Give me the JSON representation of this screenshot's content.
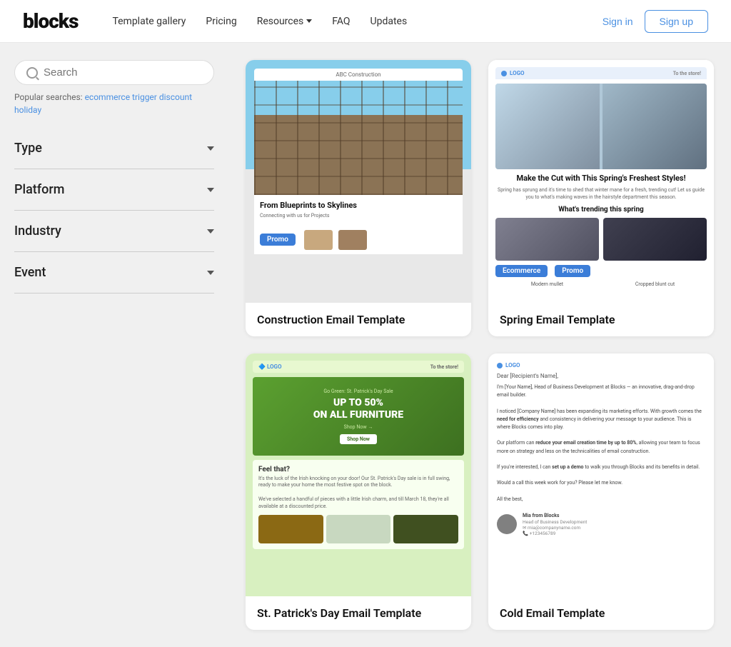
{
  "header": {
    "logo": "blocks",
    "nav": {
      "template_gallery": "Template gallery",
      "pricing": "Pricing",
      "resources": "Resources",
      "faq": "FAQ",
      "updates": "Updates",
      "sign_in": "Sign in",
      "sign_up": "Sign up"
    }
  },
  "sidebar": {
    "search": {
      "placeholder": "Search",
      "popular_label": "Popular searches:",
      "popular_links": [
        "ecommerce",
        "trigger",
        "discount",
        "holiday"
      ]
    },
    "filters": [
      {
        "label": "Type"
      },
      {
        "label": "Platform"
      },
      {
        "label": "Industry"
      },
      {
        "label": "Event"
      }
    ]
  },
  "templates": [
    {
      "id": "construction",
      "name": "Construction Email Template",
      "tags": [
        "Promo"
      ],
      "preview_company": "ABC Construction",
      "preview_tagline": "From Blueprints to Skylines"
    },
    {
      "id": "spring",
      "name": "Spring Email Template",
      "tags": [
        "Ecommerce",
        "Promo"
      ],
      "preview_heading": "Make the Cut with This Spring's Freshest Styles!",
      "preview_trending": "What's trending this spring",
      "preview_captions": [
        "Modern mullet",
        "Cropped blunt cut"
      ]
    },
    {
      "id": "stpatrick",
      "name": "St. Patrick's Day Email Template",
      "tags": [],
      "preview_company": "LOGO",
      "preview_sale": "Go Green: St. Patrick's Day Sale",
      "preview_offer": "UP TO 50%\nON ALL FURNITURE",
      "preview_subtitle": "Feel that?"
    },
    {
      "id": "cold-email",
      "name": "Cold Email Template",
      "tags": [],
      "preview_company": "LOGO",
      "preview_greeting": "Dear [Recipient's Name],",
      "preview_name": "Mia from Blocks",
      "preview_title": "Head of Business Development"
    }
  ]
}
